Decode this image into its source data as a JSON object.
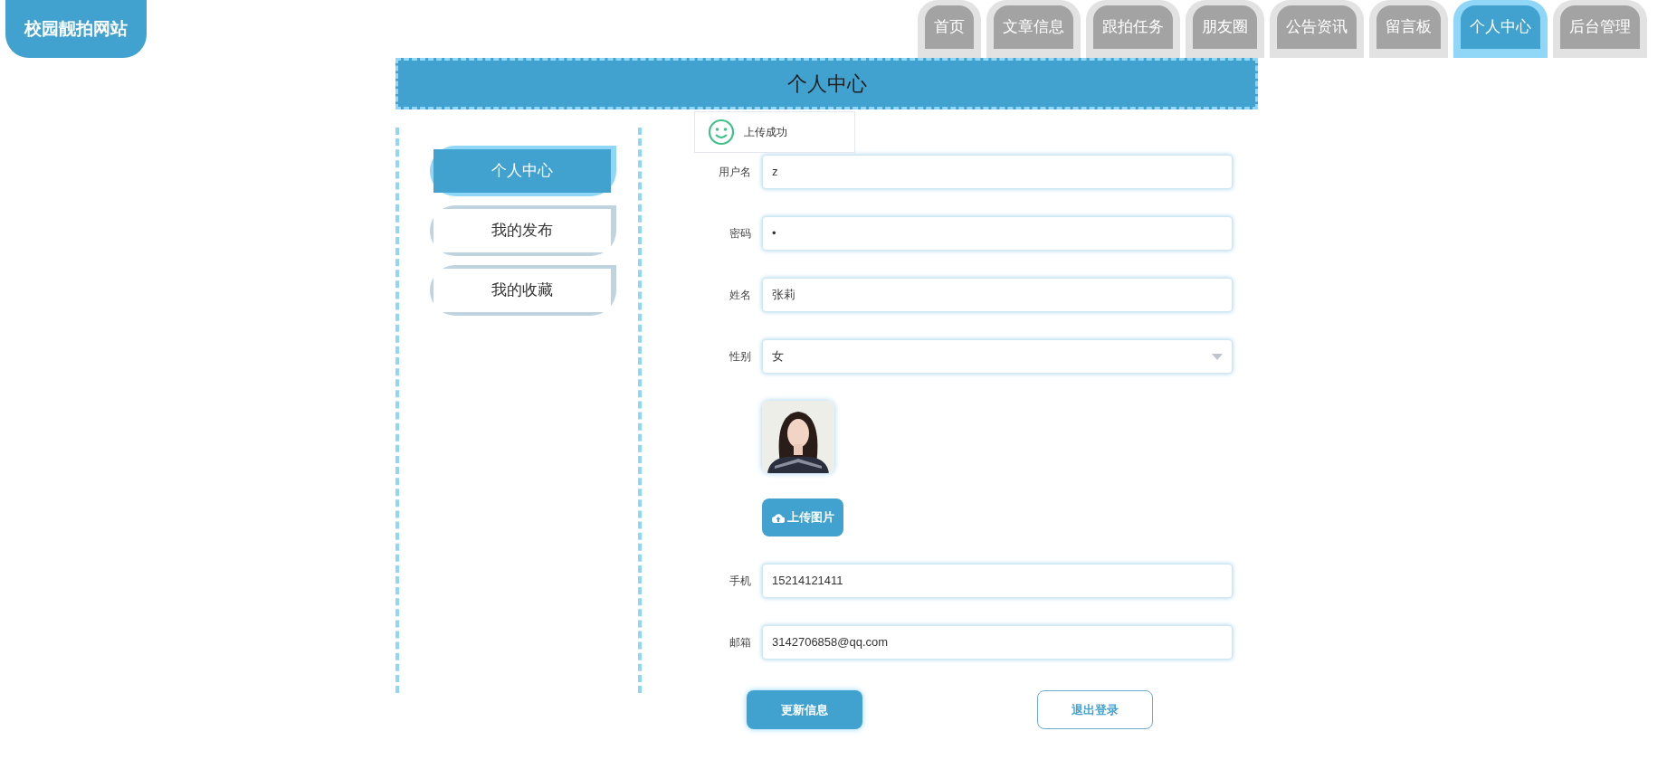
{
  "site_title": "校园靓拍网站",
  "nav": [
    {
      "label": "首页",
      "selected": false
    },
    {
      "label": "文章信息",
      "selected": false
    },
    {
      "label": "跟拍任务",
      "selected": false
    },
    {
      "label": "朋友圈",
      "selected": false
    },
    {
      "label": "公告资讯",
      "selected": false
    },
    {
      "label": "留言板",
      "selected": false
    },
    {
      "label": "个人中心",
      "selected": true
    },
    {
      "label": "后台管理",
      "selected": false
    }
  ],
  "page_title": "个人中心",
  "side_menu": [
    {
      "label": "个人中心",
      "selected": true
    },
    {
      "label": "我的发布",
      "selected": false
    },
    {
      "label": "我的收藏",
      "selected": false
    }
  ],
  "toast": {
    "message": "上传成功"
  },
  "form": {
    "fields": [
      {
        "kind": "text",
        "label": "用户名",
        "value": "z"
      },
      {
        "kind": "password",
        "label": "密码",
        "value": "•"
      },
      {
        "kind": "text",
        "label": "姓名",
        "value": "张莉"
      },
      {
        "kind": "select",
        "label": "性别",
        "value": "女"
      },
      {
        "upload_button": "上传图片"
      },
      {
        "kind": "text",
        "label": "手机",
        "value": "15214121411"
      },
      {
        "kind": "text",
        "label": "邮箱",
        "value": "3142706858@qq.com"
      }
    ],
    "buttons": [
      {
        "label": "更新信息",
        "kind": "primary"
      },
      {
        "label": "退出登录",
        "kind": "outline"
      }
    ]
  }
}
